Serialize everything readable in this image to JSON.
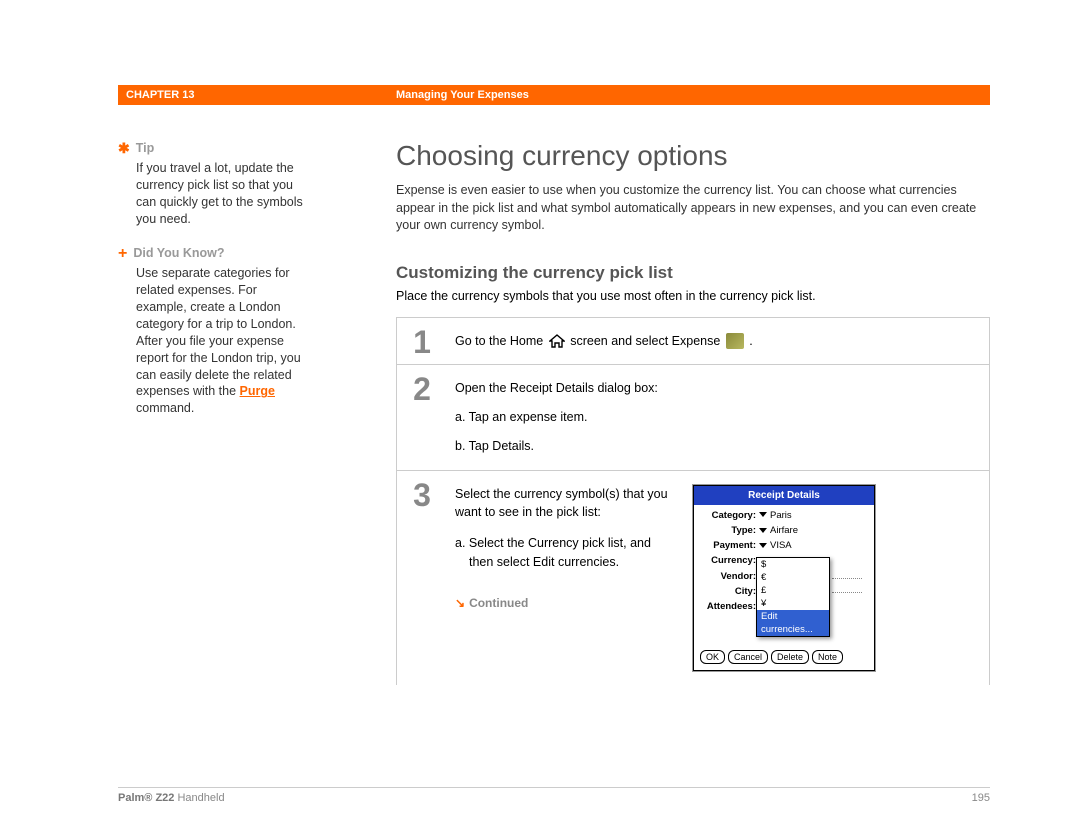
{
  "header": {
    "chapter": "CHAPTER 13",
    "title": "Managing Your Expenses"
  },
  "sidebar": {
    "tip": {
      "heading": "Tip",
      "body": "If you travel a lot, update the currency pick list so that you can quickly get to the symbols you need."
    },
    "dyk": {
      "heading": "Did You Know?",
      "body_pre": "Use separate categories for related expenses. For example, create a London category for a trip to London. After you file your expense report for the London trip, you can easily delete the related expenses with the ",
      "purge_label": "Purge",
      "body_post": " command."
    }
  },
  "main": {
    "h1": "Choosing currency options",
    "intro": "Expense is even easier to use when you customize the currency list. You can choose what currencies appear in the pick list and what symbol automatically appears in new expenses, and you can even create your own currency symbol.",
    "h2": "Customizing the currency pick list",
    "sub": "Place the currency symbols that you use most often in the currency pick list."
  },
  "steps": {
    "s1_num": "1",
    "s1_pre": "Go to the Home ",
    "s1_mid": " screen and select Expense ",
    "s1_post": ".",
    "s2_num": "2",
    "s2_head": "Open the Receipt Details dialog box:",
    "s2_a": "a.  Tap an expense item.",
    "s2_b": "b.  Tap Details.",
    "s3_num": "3",
    "s3_head": "Select the currency symbol(s) that you want to see in the pick list:",
    "s3_a": "a.  Select the Currency pick list, and then select Edit currencies.",
    "continued": "Continued"
  },
  "receipt": {
    "title": "Receipt Details",
    "labels": {
      "category": "Category:",
      "type": "Type:",
      "payment": "Payment:",
      "currency": "Currency:",
      "vendor": "Vendor:",
      "city": "City:",
      "attendees": "Attendees:"
    },
    "values": {
      "category": "Paris",
      "type": "Airfare",
      "payment": "VISA"
    },
    "popup": {
      "opt1": "$",
      "opt2": "€",
      "opt3": "£",
      "opt4": "¥",
      "edit": "Edit currencies..."
    },
    "buttons": {
      "ok": "OK",
      "cancel": "Cancel",
      "delete": "Delete",
      "note": "Note"
    }
  },
  "footer": {
    "product_bold": "Palm® Z22",
    "product_rest": " Handheld",
    "page": "195"
  }
}
